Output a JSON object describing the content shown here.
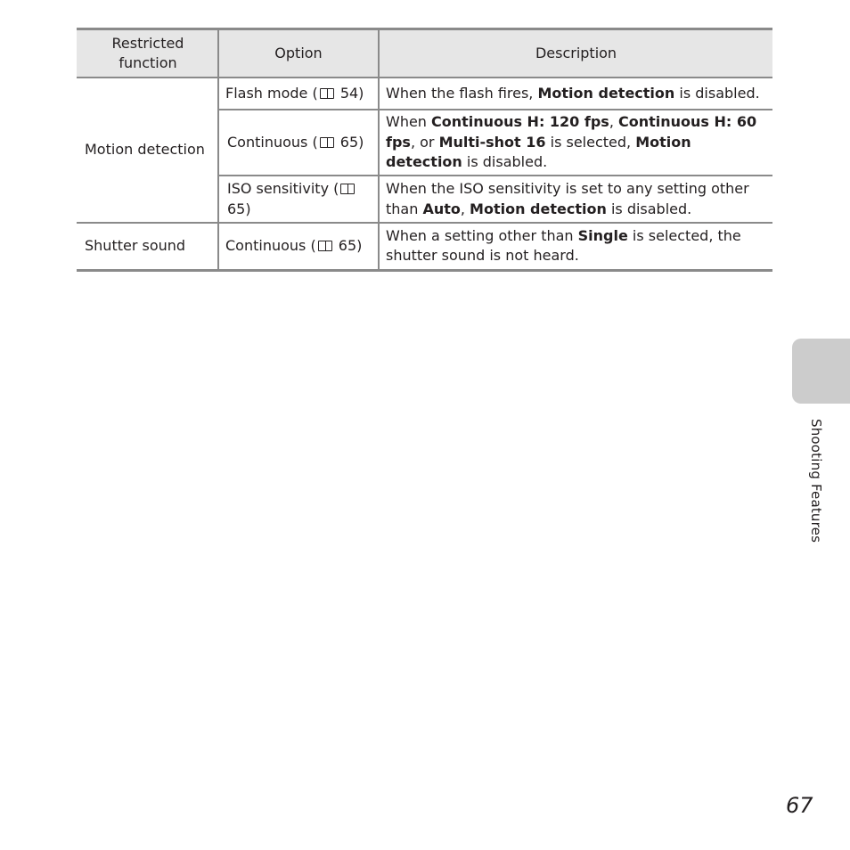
{
  "table": {
    "headers": [
      "Restricted function",
      "Option",
      "Description"
    ],
    "header_restricted_line1": "Restricted",
    "header_restricted_line2": "function",
    "groups": [
      {
        "function": "Motion detection",
        "rows": [
          {
            "option_text": "Flash mode (",
            "option_ref": "54",
            "desc_parts": [
              {
                "t": "When the flash fires, ",
                "b": false
              },
              {
                "t": "Motion detection",
                "b": true
              },
              {
                "t": " is disabled.",
                "b": false
              }
            ]
          },
          {
            "option_text": "Continuous (",
            "option_ref": "65",
            "desc_parts": [
              {
                "t": "When ",
                "b": false
              },
              {
                "t": "Continuous H: 120 fps",
                "b": true
              },
              {
                "t": ", ",
                "b": false
              },
              {
                "t": "Continuous H: 60 fps",
                "b": true
              },
              {
                "t": ", or ",
                "b": false
              },
              {
                "t": "Multi-shot 16",
                "b": true
              },
              {
                "t": " is selected, ",
                "b": false
              },
              {
                "t": "Motion detection",
                "b": true
              },
              {
                "t": " is disabled.",
                "b": false
              }
            ]
          },
          {
            "option_text": "ISO sensitivity (",
            "option_ref": "65",
            "desc_parts": [
              {
                "t": "When the ISO sensitivity is set to any setting other than ",
                "b": false
              },
              {
                "t": "Auto",
                "b": true
              },
              {
                "t": ", ",
                "b": false
              },
              {
                "t": "Motion detection",
                "b": true
              },
              {
                "t": " is disabled.",
                "b": false
              }
            ]
          }
        ]
      },
      {
        "function": "Shutter sound",
        "rows": [
          {
            "option_text": "Continuous (",
            "option_ref": "65",
            "desc_parts": [
              {
                "t": "When a setting other than ",
                "b": false
              },
              {
                "t": "Single",
                "b": true
              },
              {
                "t": " is selected, the shutter sound is not heard.",
                "b": false
              }
            ]
          }
        ]
      }
    ],
    "ref_icon": "book-reference-icon"
  },
  "side_tab": {
    "label": "Shooting Features"
  },
  "page_number": "67"
}
